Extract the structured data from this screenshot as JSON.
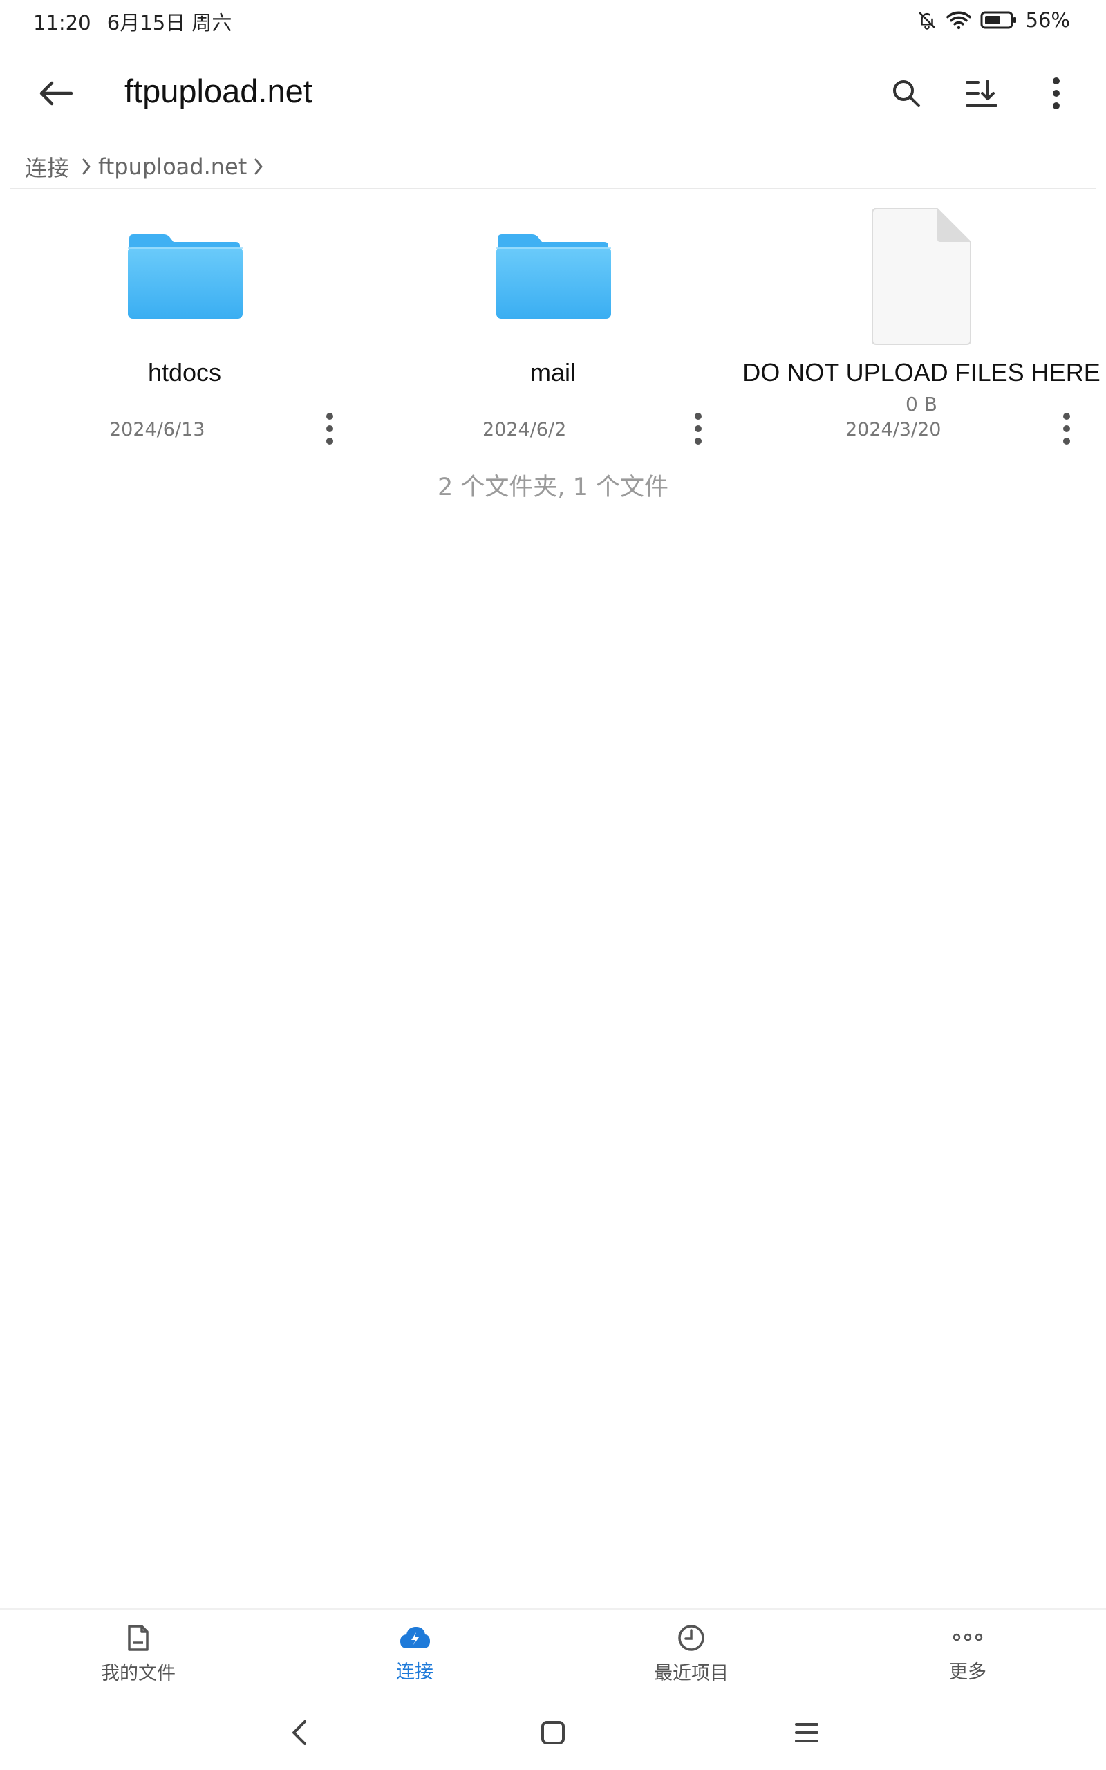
{
  "status_bar": {
    "time": "11:20",
    "date": "6月15日 周六",
    "battery": "56%",
    "icons": [
      "bell-off-icon",
      "wifi-icon",
      "battery-icon"
    ]
  },
  "app_bar": {
    "title": "ftpupload.net",
    "actions": [
      "search-icon",
      "sort-icon",
      "more-vert-icon"
    ]
  },
  "breadcrumb": {
    "root": "连接",
    "current": "ftpupload.net"
  },
  "items": [
    {
      "type": "folder",
      "name": "htdocs",
      "date": "2024/6/13",
      "size": ""
    },
    {
      "type": "folder",
      "name": "mail",
      "date": "2024/6/2",
      "size": ""
    },
    {
      "type": "file",
      "name": "DO NOT UPLOAD FILES HERE",
      "date": "2024/3/20",
      "size": "0 B"
    }
  ],
  "summary": "2 个文件夹, 1 个文件",
  "bottom_nav": [
    {
      "label": "我的文件",
      "icon": "file-icon",
      "active": false
    },
    {
      "label": "连接",
      "icon": "cloud-icon",
      "active": true
    },
    {
      "label": "最近项目",
      "icon": "clock-icon",
      "active": false
    },
    {
      "label": "更多",
      "icon": "more-horiz-icon",
      "active": false
    }
  ],
  "colors": {
    "accent": "#1E7AD9",
    "folder": "#4FB8F5",
    "text_secondary": "#777777"
  }
}
